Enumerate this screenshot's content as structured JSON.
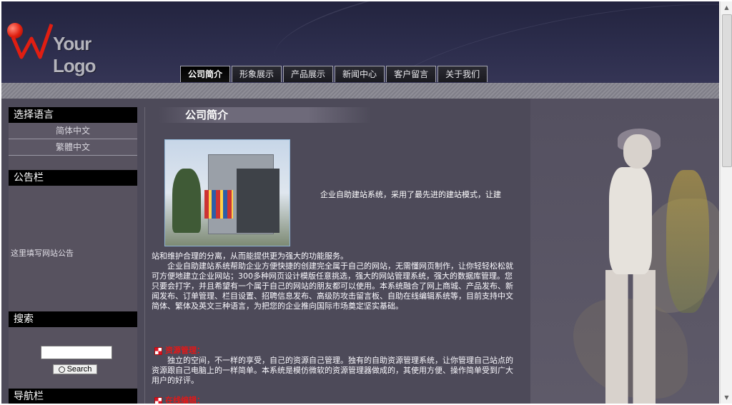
{
  "header": {
    "logo_text": "Your Logo",
    "nav": [
      {
        "label": "公司简介",
        "active": true
      },
      {
        "label": "形象展示",
        "active": false
      },
      {
        "label": "产品展示",
        "active": false
      },
      {
        "label": "新闻中心",
        "active": false
      },
      {
        "label": "客户留言",
        "active": false
      },
      {
        "label": "关于我们",
        "active": false
      }
    ]
  },
  "sidebar": {
    "language": {
      "title": "选择语言",
      "items": [
        "简体中文",
        "繁體中文"
      ]
    },
    "notice": {
      "title": "公告栏",
      "text": "这里填写网站公告"
    },
    "search": {
      "title": "搜索",
      "input_value": "",
      "button_label": "Search"
    },
    "bottom_title": "导航栏"
  },
  "main": {
    "title": "公司简介",
    "intro_tail": "企业自助建站系统，采用了最先进的建站模式，让建",
    "para1": "站和维护合理的分离，从而能提供更为强大的功能服务。",
    "para2": "企业自助建站系统帮助企业方便快捷的创建完全属于自己的网站，无需懂网页制作，让你轻轻松松就可方便地建立企业网站；300多种网页设计模版任意挑选，强大的网站管理系统，强大的数据库管理。您只要会打字，并且希望有一个属于自己的网站的朋友都可以使用。本系统融合了网上商城、产品发布、新闻发布、订单管理、栏目设置、招聘信息发布、高级防攻击留言板、自助在线编辑系统等，目前支持中文简体、繁体及英文三种语言，为把您的企业推向国际市场奠定坚实基础。",
    "section1_title": "资源管理：",
    "section1_text": "独立的空间，不一样的享受，自己的资源自己管理。独有的自助资源管理系统，让你管理自己站点的资源跟自己电脑上的一样简单。本系统是模仿微软的资源管理器做成的，其使用方便、操作简单受到广大用户的好评。",
    "section2_title": "在线编辑："
  }
}
